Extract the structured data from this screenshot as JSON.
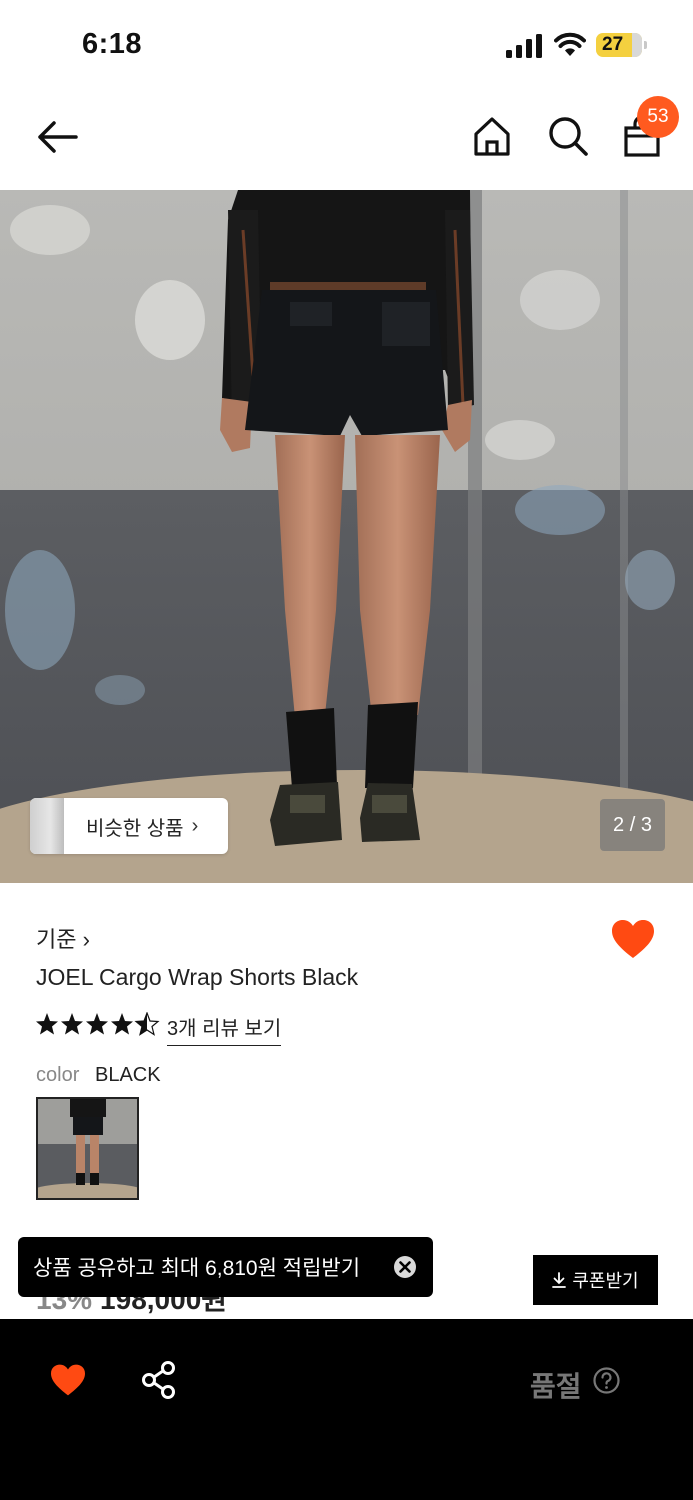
{
  "status_bar": {
    "time": "6:18",
    "battery": "27"
  },
  "header": {
    "cart_count": "53"
  },
  "gallery": {
    "similar_label": "비슷한 상품",
    "page_indicator": "2 / 3"
  },
  "product": {
    "brand": "기준 ›",
    "name": "JOEL Cargo Wrap Shorts Black",
    "rating": 4.5,
    "review_link": "3개 리뷰 보기",
    "color_label": "color",
    "color_value": "BLACK",
    "discount_peek": "13%",
    "price_peek": "198,000원"
  },
  "toast": {
    "message": "상품 공유하고 최대 6,810원 적립받기"
  },
  "coupon": {
    "label": "쿠폰받기"
  },
  "bottom_bar": {
    "soldout_label": "품절"
  },
  "colors": {
    "accent": "#ff5a1f",
    "heart": "#ff4a12",
    "bar": "#000000"
  }
}
